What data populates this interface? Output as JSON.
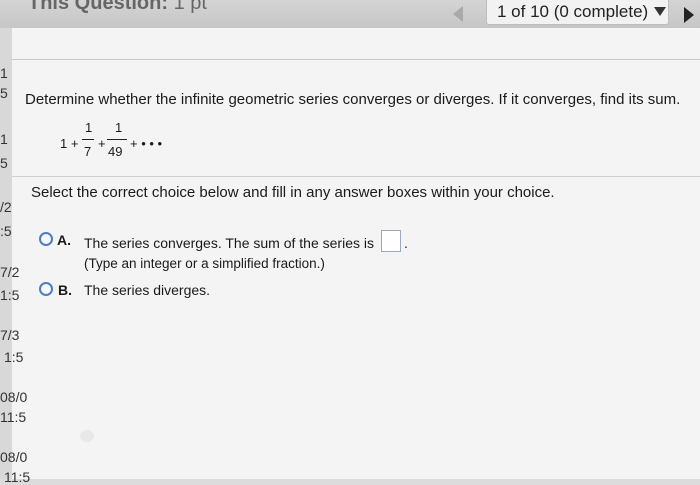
{
  "header": {
    "title": "This Question:",
    "points": "1 pt",
    "progress": "1 of 10 (0 complete)"
  },
  "sidebar": {
    "values": [
      "1",
      "5",
      "1",
      "5",
      "/2",
      ":5",
      "7/2",
      "1:5",
      "7/3",
      "1:5",
      "08/0",
      "11:5",
      "08/0",
      "11:5"
    ]
  },
  "question": {
    "prompt": "Determine whether the infinite geometric series converges or diverges. If it converges, find its sum.",
    "series": {
      "lead": "1 +",
      "n1": "1",
      "d1": "7",
      "plus": "+",
      "n2": "1",
      "d2": "49",
      "tail": "+ • • •"
    },
    "instruction": "Select the correct choice below and fill in any answer boxes within your choice."
  },
  "choices": [
    {
      "letter": "A.",
      "text": "The series converges. The sum of the series is",
      "hint": "(Type an integer or a simplified fraction.)",
      "answer_value": ""
    },
    {
      "letter": "B.",
      "text": "The series diverges."
    }
  ],
  "colors": {
    "radio_border": "#4a7fc4",
    "panel_bg": "#f4f4f4"
  }
}
